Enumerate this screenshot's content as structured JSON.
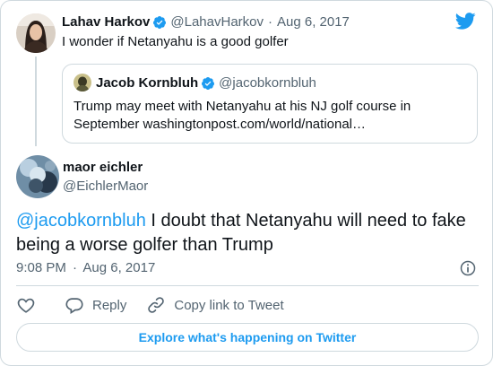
{
  "parent_tweet": {
    "name": "Lahav Harkov",
    "handle": "@LahavHarkov",
    "separator": "·",
    "date": "Aug 6, 2017",
    "text": "I wonder if Netanyahu is a good golfer"
  },
  "quoted_tweet": {
    "name": "Jacob Kornbluh",
    "handle": "@jacobkornbluh",
    "text": "Trump may meet with Netanyahu at his NJ golf course in September washingtonpost.com/world/national…"
  },
  "main_tweet": {
    "name": "maor eichler",
    "handle": "@EichlerMaor",
    "mention": "@jacobkornbluh",
    "text": " I doubt that Netanyahu will need to fake being a worse golfer than Trump",
    "time": "9:08 PM",
    "separator": "·",
    "date": "Aug 6, 2017"
  },
  "actions": {
    "reply_label": "Reply",
    "copy_link_label": "Copy link to Tweet"
  },
  "explore_label": "Explore what's happening on Twitter",
  "colors": {
    "accent": "#1d9bf0",
    "text": "#0f1419",
    "muted": "#536471",
    "border": "#cfd9de",
    "verified": "#1d9bf0"
  },
  "icons": {
    "logo": "twitter-bird-icon",
    "verified": "verified-badge-icon",
    "info": "info-icon",
    "like": "heart-icon",
    "reply": "reply-bubble-icon",
    "copy_link": "link-icon"
  }
}
